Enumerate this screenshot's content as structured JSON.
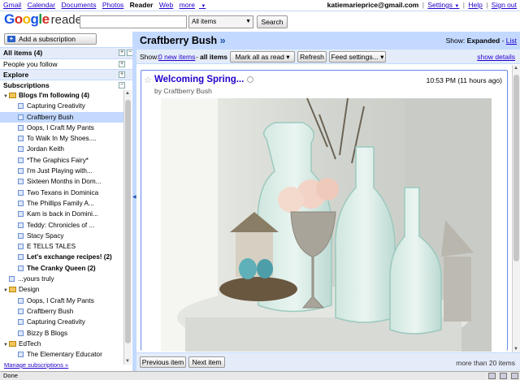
{
  "gbar": {
    "links": [
      "Gmail",
      "Calendar",
      "Documents",
      "Photos",
      "Reader",
      "Web",
      "more"
    ],
    "more_arrow": "▼",
    "email": "katiemarieprice@gmail.com",
    "settings": "Settings",
    "settings_arrow": "▼",
    "help": "Help",
    "signout": "Sign out",
    "sep": "|"
  },
  "logo": {
    "letters": [
      "G",
      "o",
      "o",
      "g",
      "l",
      "e"
    ],
    "product": "reader"
  },
  "search": {
    "value": "",
    "scope": "All items",
    "button": "Search"
  },
  "nav": {
    "add_subscription": "Add a subscription",
    "all_items": "All items (4)",
    "people_you_follow": "People you follow",
    "explore": "Explore",
    "subscriptions": "Subscriptions",
    "items": [
      {
        "type": "folder",
        "label": "Blogs I'm following (4)",
        "bold": true,
        "indent": 0
      },
      {
        "type": "feed",
        "label": "Capturing Creativity",
        "bold": false,
        "indent": 1
      },
      {
        "type": "feed",
        "label": "Craftberry Bush",
        "bold": false,
        "indent": 1,
        "selected": true
      },
      {
        "type": "feed",
        "label": "Oops, I Craft My Pants",
        "bold": false,
        "indent": 1
      },
      {
        "type": "feed",
        "label": "To Walk In My Shoes....",
        "bold": false,
        "indent": 1
      },
      {
        "type": "feed",
        "label": "Jordan Keith",
        "bold": false,
        "indent": 1
      },
      {
        "type": "feed",
        "label": "*The Graphics Fairy*",
        "bold": false,
        "indent": 1
      },
      {
        "type": "feed",
        "label": "I'm Just Playing with...",
        "bold": false,
        "indent": 1
      },
      {
        "type": "feed",
        "label": "Sixteen Months in Dom...",
        "bold": false,
        "indent": 1
      },
      {
        "type": "feed",
        "label": "Two Texans in Dominica",
        "bold": false,
        "indent": 1
      },
      {
        "type": "feed",
        "label": "The Phillips Family A...",
        "bold": false,
        "indent": 1
      },
      {
        "type": "feed",
        "label": "Kam is back in Domini...",
        "bold": false,
        "indent": 1
      },
      {
        "type": "feed",
        "label": "Teddy: Chronicles of ...",
        "bold": false,
        "indent": 1
      },
      {
        "type": "feed",
        "label": "Stacy Spacy",
        "bold": false,
        "indent": 1
      },
      {
        "type": "feed",
        "label": "E TELLS TALES",
        "bold": false,
        "indent": 1
      },
      {
        "type": "feed",
        "label": "Let's exchange recipes! (2)",
        "bold": true,
        "indent": 1
      },
      {
        "type": "feed",
        "label": "The Cranky Queen (2)",
        "bold": true,
        "indent": 1
      },
      {
        "type": "feed",
        "label": "...yours truly",
        "bold": false,
        "indent": 0
      },
      {
        "type": "folder",
        "label": "Design",
        "bold": false,
        "indent": 0
      },
      {
        "type": "feed",
        "label": "Oops, I Craft My Pants",
        "bold": false,
        "indent": 1
      },
      {
        "type": "feed",
        "label": "Craftberry Bush",
        "bold": false,
        "indent": 1
      },
      {
        "type": "feed",
        "label": "Capturing Creativity",
        "bold": false,
        "indent": 1
      },
      {
        "type": "feed",
        "label": "Bizzy B Blogs",
        "bold": false,
        "indent": 1
      },
      {
        "type": "folder",
        "label": "EdTech",
        "bold": false,
        "indent": 0
      },
      {
        "type": "feed",
        "label": "The Elementary Educator",
        "bold": false,
        "indent": 1
      }
    ],
    "manage_subscriptions": "Manage subscriptions »"
  },
  "main": {
    "feed_title": "Craftberry Bush",
    "feed_title_arrow": "»",
    "show_label": "Show:",
    "show_expanded": "Expanded",
    "show_dash": " - ",
    "show_list": "List",
    "toolbar": {
      "show": "Show:",
      "new_items": "0 new items",
      "dash": " - ",
      "all_items": "all items",
      "mark_all_read": "Mark all as read",
      "refresh": "Refresh",
      "feed_settings": "Feed settings...",
      "dropdown_arrow": "▾",
      "show_details": "show details"
    },
    "entry": {
      "star": "☆",
      "title": "Welcoming Spring...",
      "date": "10:53 PM (11 hours ago)",
      "author": "by Craftberry Bush"
    },
    "footer": {
      "previous": "Previous item",
      "next": "Next item",
      "count": "more than 20 items"
    }
  },
  "statusbar": {
    "text": "Done"
  },
  "colors": {
    "link": "#2200cc",
    "header_blue": "#c3d9ff",
    "toolbar_blue": "#e5ecf9",
    "entry_border": "#6688ee"
  }
}
